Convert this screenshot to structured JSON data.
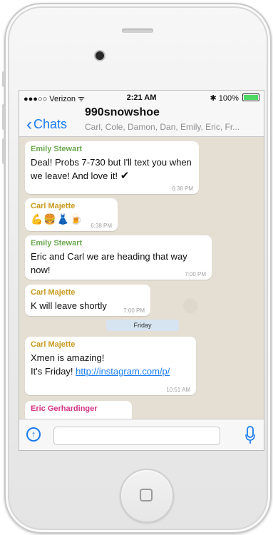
{
  "status_bar": {
    "carrier": "●●●○○ Verizon ᯤ",
    "time": "2:21 AM",
    "battery": "✱ 100%"
  },
  "nav": {
    "back_label": "Chats",
    "title": "990snowshoe",
    "members": "Carl, Cole, Damon, Dan, Emily, Eric, Fr..."
  },
  "messages": [
    {
      "sender": "Emily Stewart",
      "sender_color": "#6aa84f",
      "text": "Deal! Probs 7-730 but I'll text you when we leave! And love it!",
      "extra": "✔",
      "time": "6:38 PM"
    },
    {
      "sender": "Carl Majette",
      "sender_color": "#c79a1f",
      "text": "💪🍔👗🍺",
      "time": "6:38 PM"
    },
    {
      "sender": "Emily Stewart",
      "sender_color": "#6aa84f",
      "text": "Eric and Carl we are heading that way now!",
      "time": "7:00 PM"
    },
    {
      "sender": "Carl Majette",
      "sender_color": "#c79a1f",
      "text": "K will leave shortly",
      "time": "7:00 PM"
    },
    {
      "sender": "Carl Majette",
      "sender_color": "#c79a1f",
      "text_line1": "Xmen is amazing!",
      "text_line2_prefix": "It's Friday! ",
      "link": "http://instagram.com/p/",
      "time": "10:51 AM"
    },
    {
      "sender": "Eric Gerhardinger",
      "sender_color": "#d63384"
    }
  ],
  "day_divider": "Friday",
  "input": {
    "value": "",
    "placeholder": ""
  },
  "icons": {
    "upload": "upload-arrow-icon",
    "mic": "microphone-icon",
    "back": "chevron-left-icon"
  },
  "colors": {
    "accent": "#1a7cf0",
    "chat_background": "#e5dfd3"
  }
}
